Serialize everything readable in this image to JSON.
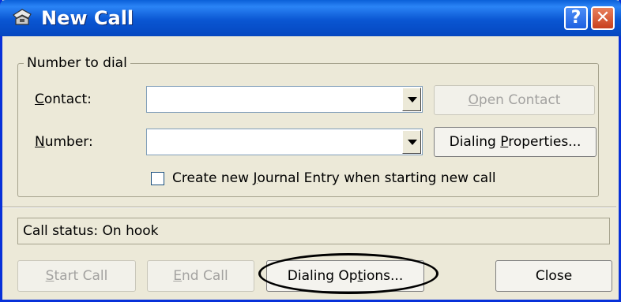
{
  "window": {
    "title": "New Call",
    "help_glyph": "?",
    "close_glyph": "✕"
  },
  "group": {
    "legend": "Number to dial"
  },
  "fields": {
    "contact": {
      "label_u": "C",
      "label_rest": "ontact:",
      "value": ""
    },
    "number": {
      "label_u": "N",
      "label_rest": "umber:",
      "value": ""
    }
  },
  "buttons": {
    "open_contact": {
      "u": "O",
      "rest": "pen Contact"
    },
    "dialing_properties": {
      "pre": "Dialing ",
      "u": "P",
      "rest": "roperties..."
    },
    "start_call": {
      "u": "S",
      "rest": "tart Call"
    },
    "end_call": {
      "u": "E",
      "rest": "nd Call"
    },
    "dialing_options": {
      "pre": "Dialing Op",
      "u": "t",
      "rest": "ions..."
    },
    "close": "Close"
  },
  "journal": {
    "pre": "Create new ",
    "u": "J",
    "rest": "ournal Entry when starting new call",
    "checked": false
  },
  "status": {
    "text": "Call status: On hook"
  }
}
